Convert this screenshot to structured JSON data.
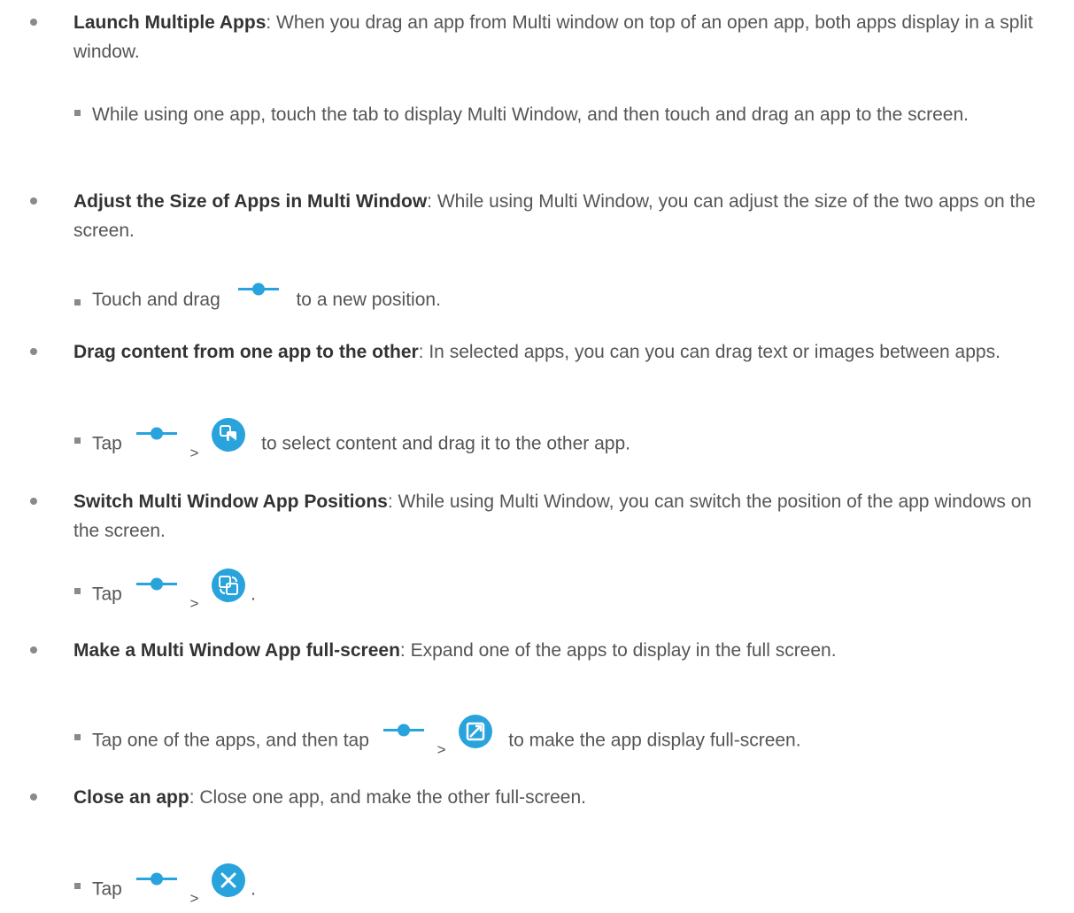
{
  "items": [
    {
      "title": "Launch Multiple Apps",
      "body": ": When you drag an app from Multi window on top of an open app, both apps display in a split window.",
      "sub": "While using one app, touch the tab to display Multi Window, and then touch and drag an app to the screen."
    },
    {
      "title": "Adjust the Size of Apps in Multi Window",
      "body": ": While using Multi Window, you can adjust the size of the two apps on the screen.",
      "sub_before": "Touch and drag",
      "sub_after": "to a new position."
    },
    {
      "title": "Drag content from one app to the other",
      "body": ": In selected apps, you can you can drag text or images between apps.",
      "sub_before": "Tap",
      "sub_gt": ">",
      "sub_after": "to select content and drag it to the other app."
    },
    {
      "title": "Switch Multi Window App Positions",
      "body": ": While using Multi Window, you can switch the position of the app windows on the screen.",
      "sub_before": "Tap",
      "sub_gt": ">",
      "sub_after": "."
    },
    {
      "title": "Make a Multi Window App full-screen",
      "body": ": Expand one of the apps to display in the full screen.",
      "sub_before": "Tap one of the apps, and then tap",
      "sub_gt": ">",
      "sub_after": "to make the app display full-screen."
    },
    {
      "title": "Close an app",
      "body": ": Close one app, and make the other full-screen.",
      "sub_before": "Tap",
      "sub_gt": ">",
      "sub_after": "."
    }
  ],
  "icons": {
    "handle": "window-divider-handle-icon",
    "drag_content": "drag-content-icon",
    "switch": "switch-windows-icon",
    "fullscreen": "fullscreen-icon",
    "close": "close-app-icon"
  },
  "colors": {
    "icon_blue": "#29a3dc",
    "text": "#555555",
    "bold_text": "#333333"
  }
}
